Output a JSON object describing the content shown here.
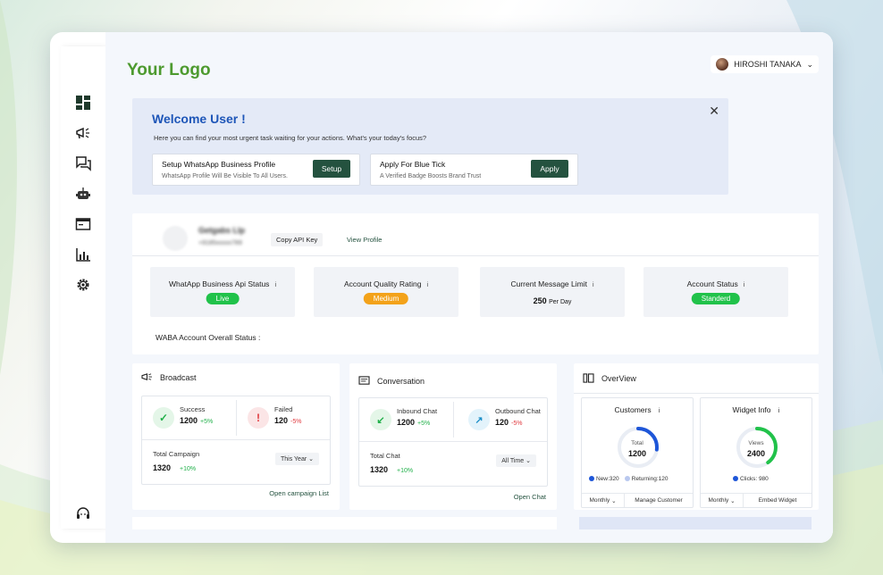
{
  "brand": {
    "logo_text": "Your Logo",
    "accent": "#4d9a2f",
    "dark_green": "#24523f"
  },
  "user": {
    "name": "HIROSHI TANAKA",
    "chevron": "⌄"
  },
  "sidebar": {
    "items": [
      {
        "name": "dashboard",
        "icon": "dashboard-icon"
      },
      {
        "name": "broadcast",
        "icon": "megaphone-icon"
      },
      {
        "name": "conversation",
        "icon": "chat-icon"
      },
      {
        "name": "bot",
        "icon": "robot-icon"
      },
      {
        "name": "templates",
        "icon": "browser-window-icon"
      },
      {
        "name": "analytics",
        "icon": "bar-chart-icon"
      },
      {
        "name": "settings",
        "icon": "gear-icon"
      },
      {
        "name": "support",
        "icon": "headset-icon"
      }
    ]
  },
  "welcome": {
    "title": "Welcome  User !",
    "subtitle": "Here you can find your most urgent task waiting for your actions. What's your today's focus?",
    "close": "✕",
    "tasks": [
      {
        "title": "Setup  WhatsApp Business Profile",
        "desc": "WhatsApp Profile  Will Be Visible To All Users.",
        "button": "Setup"
      },
      {
        "title": "Apply For Blue Tick",
        "desc": "A Verified Badge Boosts Brand Trust",
        "button": "Apply"
      }
    ]
  },
  "profile": {
    "name": "Getgabs Llp",
    "phone": "+9185xxxxx789",
    "copy_api": "Copy API Key",
    "view_profile": "View Profile",
    "stats": [
      {
        "label": "WhatApp Business Api Status",
        "info": "i",
        "badge": "Live",
        "badge_color": "#21c24a"
      },
      {
        "label": "Account Quality Rating",
        "info": "i",
        "badge": "Medium",
        "badge_color": "#f3a21a"
      },
      {
        "label": "Current Message Limit",
        "info": "i",
        "value": "250",
        "unit": "Per Day"
      },
      {
        "label": "Account Status",
        "info": "i",
        "badge": "Standerd",
        "badge_color": "#21c24a"
      }
    ],
    "waba_label": "WABA Account Overall Status :"
  },
  "broadcast": {
    "title": "Broadcast",
    "success_label": "Success",
    "success_value": "1200",
    "success_delta": "+5%",
    "failed_label": "Failed",
    "failed_value": "120",
    "failed_delta": "-5%",
    "total_label": "Total Campaign",
    "total_value": "1320",
    "total_delta": "+10%",
    "period": "This Year",
    "link": "Open campaign List"
  },
  "conversation": {
    "title": "Conversation",
    "inbound_label": "Inbound Chat",
    "inbound_value": "1200",
    "inbound_delta": "+5%",
    "outbound_label": "Outbound Chat",
    "outbound_value": "120",
    "outbound_delta": "-5%",
    "total_label": "Total Chat",
    "total_value": "1320",
    "total_delta": "+10%",
    "period": "All Time",
    "link": "Open Chat"
  },
  "overview": {
    "title": "OverView",
    "customers": {
      "title": "Customers",
      "info": "i",
      "center_label": "Total",
      "center_value": "1200",
      "progress": 0.27,
      "color": "#1e56d8",
      "legend": [
        {
          "text": "New:320",
          "color": "#1e56d8"
        },
        {
          "text": "Returning:120",
          "color": "#b9c8ef"
        }
      ],
      "period": "Monthly",
      "action": "Manage Customer"
    },
    "widget": {
      "title": "Widget Info",
      "info": "i",
      "center_label": "Views",
      "center_value": "2400",
      "progress": 0.4,
      "color": "#21c24a",
      "legend": [
        {
          "text": "Clicks: 980",
          "color": "#1e56d8"
        }
      ],
      "period": "Monthly",
      "action": "Embed Widget"
    }
  }
}
